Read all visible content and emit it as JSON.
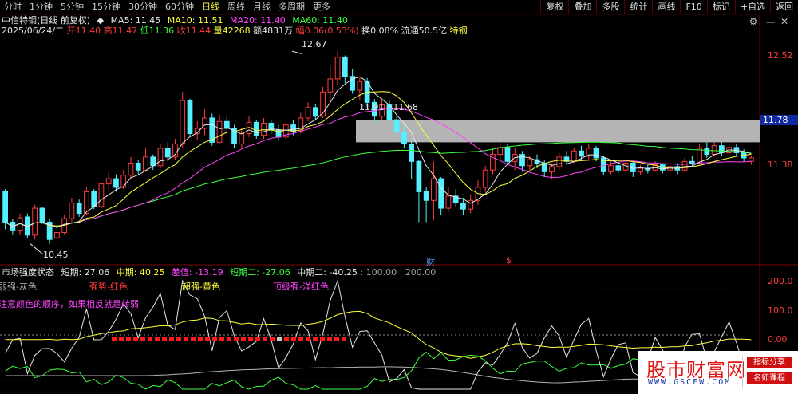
{
  "period_tabs": [
    {
      "label": "分时",
      "active": false
    },
    {
      "label": "1分钟",
      "active": false
    },
    {
      "label": "5分钟",
      "active": false
    },
    {
      "label": "15分钟",
      "active": false
    },
    {
      "label": "30分钟",
      "active": false
    },
    {
      "label": "60分钟",
      "active": false
    },
    {
      "label": "日线",
      "active": true
    },
    {
      "label": "周线",
      "active": false
    },
    {
      "label": "月线",
      "active": false
    },
    {
      "label": "多周期",
      "active": false
    },
    {
      "label": "更多",
      "active": false
    }
  ],
  "toolbar": [
    "复权",
    "叠加",
    "多股",
    "统计",
    "画线",
    "F10",
    "标记",
    "+自选",
    "返回"
  ],
  "stock": {
    "title": "中信特钢(日线 前复权)",
    "ma5": "MA5: 11.45",
    "ma10": "MA10: 11.51",
    "ma20": "MA20: 11.40",
    "ma60": "MA60: 11.40",
    "date": "2025/06/24/二",
    "open": "开11.40",
    "high": "高11.47",
    "low": "低11.36",
    "close": "收11.44",
    "volume": "量42268",
    "amount": "额4831万",
    "change": "幅0.06(0.53%)",
    "turnover": "换0.08%",
    "float_value": "流通50.5亿",
    "tag": "特钢"
  },
  "price_axis": [
    "12.52",
    "11.38"
  ],
  "current_price": "11.78",
  "annotations": {
    "high": "12.67",
    "low": "10.45",
    "range": "11.91 - 11.68"
  },
  "event_marks": [
    "财",
    "$"
  ],
  "indicator": {
    "name": "市场强度状态",
    "short": "短期: 27.06",
    "mid": "中期: 40.25",
    "diff": "差值: -13.19",
    "short2": "短期二: -27.06",
    "mid2": "中期二: -40.25",
    "levels": ": 100.00 : 200.00",
    "axis": [
      "200.0",
      "100.0",
      "0.00"
    ],
    "legend": [
      "弱强-灰色",
      "强势-红色",
      "超强-黄色",
      "顶级强-洋红色"
    ],
    "note": "注意颜色的顺序，如果相反就是转弱"
  },
  "chart_data": {
    "type": "candlestick",
    "price_range": [
      10.3,
      12.8
    ],
    "indicator_range": [
      -20,
      220
    ],
    "candles": [
      [
        11.05,
        10.7,
        11.08,
        10.62
      ],
      [
        10.7,
        10.6,
        10.74,
        10.55
      ],
      [
        10.6,
        10.75,
        10.8,
        10.55
      ],
      [
        10.76,
        10.55,
        10.8,
        10.52
      ],
      [
        10.55,
        10.86,
        10.9,
        10.5
      ],
      [
        10.86,
        10.7,
        10.88,
        10.68
      ],
      [
        10.7,
        10.5,
        10.74,
        10.45
      ],
      [
        10.52,
        10.58,
        10.62,
        10.48
      ],
      [
        10.58,
        10.74,
        10.78,
        10.55
      ],
      [
        10.74,
        10.92,
        10.98,
        10.7
      ],
      [
        10.92,
        10.8,
        10.96,
        10.76
      ],
      [
        10.8,
        11.05,
        11.1,
        10.78
      ],
      [
        11.05,
        10.88,
        11.08,
        10.85
      ],
      [
        10.88,
        11.14,
        11.16,
        10.86
      ],
      [
        11.14,
        11.2,
        11.28,
        11.08
      ],
      [
        11.2,
        11.1,
        11.25,
        11.05
      ],
      [
        11.1,
        11.24,
        11.3,
        11.08
      ],
      [
        11.24,
        11.38,
        11.45,
        11.2
      ],
      [
        11.38,
        11.3,
        11.42,
        11.25
      ],
      [
        11.3,
        11.45,
        11.55,
        11.28
      ],
      [
        11.45,
        11.35,
        11.48,
        11.3
      ],
      [
        11.35,
        11.55,
        11.6,
        11.32
      ],
      [
        11.55,
        11.45,
        11.62,
        11.4
      ],
      [
        11.45,
        11.6,
        11.66,
        11.42
      ],
      [
        11.6,
        12.1,
        12.2,
        11.55
      ],
      [
        12.1,
        11.72,
        12.12,
        11.68
      ],
      [
        11.72,
        11.78,
        11.86,
        11.65
      ],
      [
        11.78,
        11.9,
        12.0,
        11.7
      ],
      [
        11.9,
        11.62,
        11.95,
        11.58
      ],
      [
        11.62,
        11.86,
        11.94,
        11.6
      ],
      [
        11.86,
        11.78,
        11.92,
        11.72
      ],
      [
        11.78,
        11.6,
        11.82,
        11.55
      ],
      [
        11.6,
        11.72,
        11.78,
        11.56
      ],
      [
        11.72,
        11.85,
        11.92,
        11.68
      ],
      [
        11.85,
        11.7,
        11.88,
        11.66
      ],
      [
        11.7,
        11.84,
        11.9,
        11.66
      ],
      [
        11.84,
        11.76,
        11.88,
        11.72
      ],
      [
        11.76,
        11.68,
        11.82,
        11.64
      ],
      [
        11.68,
        11.82,
        11.86,
        11.65
      ],
      [
        11.82,
        11.74,
        11.88,
        11.7
      ],
      [
        11.74,
        11.9,
        11.96,
        11.72
      ],
      [
        11.9,
        12.02,
        12.08,
        11.86
      ],
      [
        12.02,
        11.92,
        12.06,
        11.88
      ],
      [
        11.92,
        12.2,
        12.26,
        11.9
      ],
      [
        12.2,
        12.35,
        12.5,
        12.1
      ],
      [
        12.35,
        12.6,
        12.67,
        12.28
      ],
      [
        12.6,
        12.38,
        12.62,
        12.3
      ],
      [
        12.38,
        12.22,
        12.46,
        12.18
      ],
      [
        12.22,
        12.32,
        12.36,
        12.1
      ],
      [
        12.32,
        12.08,
        12.36,
        12.02
      ],
      [
        12.08,
        11.92,
        12.12,
        11.85
      ],
      [
        11.92,
        12.05,
        12.1,
        11.88
      ],
      [
        12.05,
        11.88,
        12.1,
        11.84
      ],
      [
        11.88,
        11.74,
        11.92,
        11.68
      ],
      [
        11.74,
        11.6,
        11.82,
        11.55
      ],
      [
        11.6,
        11.4,
        11.66,
        11.2
      ],
      [
        11.4,
        11.05,
        11.42,
        10.7
      ],
      [
        11.05,
        10.95,
        11.1,
        10.7
      ],
      [
        10.95,
        11.2,
        11.4,
        10.72
      ],
      [
        11.2,
        10.86,
        11.22,
        10.78
      ],
      [
        10.86,
        11.0,
        11.1,
        10.82
      ],
      [
        11.0,
        10.92,
        11.08,
        10.88
      ],
      [
        10.92,
        10.85,
        10.98,
        10.78
      ],
      [
        10.85,
        10.95,
        11.02,
        10.8
      ],
      [
        10.95,
        11.1,
        11.18,
        10.9
      ],
      [
        11.1,
        11.3,
        11.35,
        11.05
      ],
      [
        11.3,
        11.48,
        11.55,
        11.25
      ],
      [
        11.48,
        11.56,
        11.62,
        11.4
      ],
      [
        11.56,
        11.4,
        11.6,
        11.36
      ],
      [
        11.4,
        11.48,
        11.55,
        11.3
      ],
      [
        11.48,
        11.35,
        11.52,
        11.28
      ],
      [
        11.35,
        11.42,
        11.46,
        11.3
      ],
      [
        11.42,
        11.38,
        11.48,
        11.32
      ],
      [
        11.38,
        11.28,
        11.42,
        11.22
      ],
      [
        11.28,
        11.34,
        11.38,
        11.2
      ],
      [
        11.34,
        11.45,
        11.5,
        11.3
      ],
      [
        11.45,
        11.4,
        11.52,
        11.36
      ],
      [
        11.4,
        11.52,
        11.56,
        11.38
      ],
      [
        11.52,
        11.46,
        11.58,
        11.42
      ],
      [
        11.46,
        11.55,
        11.6,
        11.42
      ],
      [
        11.55,
        11.44,
        11.58,
        11.4
      ],
      [
        11.44,
        11.28,
        11.46,
        11.24
      ],
      [
        11.28,
        11.35,
        11.4,
        11.25
      ],
      [
        11.35,
        11.3,
        11.38,
        11.26
      ],
      [
        11.3,
        11.38,
        11.42,
        11.28
      ],
      [
        11.38,
        11.28,
        11.4,
        11.22
      ],
      [
        11.28,
        11.32,
        11.36,
        11.24
      ],
      [
        11.32,
        11.3,
        11.36,
        11.26
      ],
      [
        11.3,
        11.36,
        11.4,
        11.28
      ],
      [
        11.36,
        11.3,
        11.38,
        11.26
      ],
      [
        11.3,
        11.34,
        11.38,
        11.27
      ],
      [
        11.34,
        11.3,
        11.38,
        11.25
      ],
      [
        11.3,
        11.4,
        11.44,
        11.28
      ],
      [
        11.4,
        11.38,
        11.46,
        11.34
      ],
      [
        11.38,
        11.55,
        11.6,
        11.36
      ],
      [
        11.55,
        11.48,
        11.62,
        11.44
      ],
      [
        11.48,
        11.58,
        11.62,
        11.46
      ],
      [
        11.58,
        11.5,
        11.62,
        11.46
      ],
      [
        11.5,
        11.56,
        11.6,
        11.46
      ],
      [
        11.56,
        11.5,
        11.6,
        11.46
      ],
      [
        11.5,
        11.44,
        11.54,
        11.4
      ],
      [
        11.4,
        11.44,
        11.47,
        11.36
      ]
    ]
  },
  "colors": {
    "up": "#ff3c3c",
    "down": "#54f0ff",
    "ma5": "#e6e6e6",
    "ma10": "#ffff3c",
    "ma20": "#ff44ff",
    "ma60": "#3cff3c",
    "zone": "#b4b4b4",
    "divider": "#7a0000"
  }
}
